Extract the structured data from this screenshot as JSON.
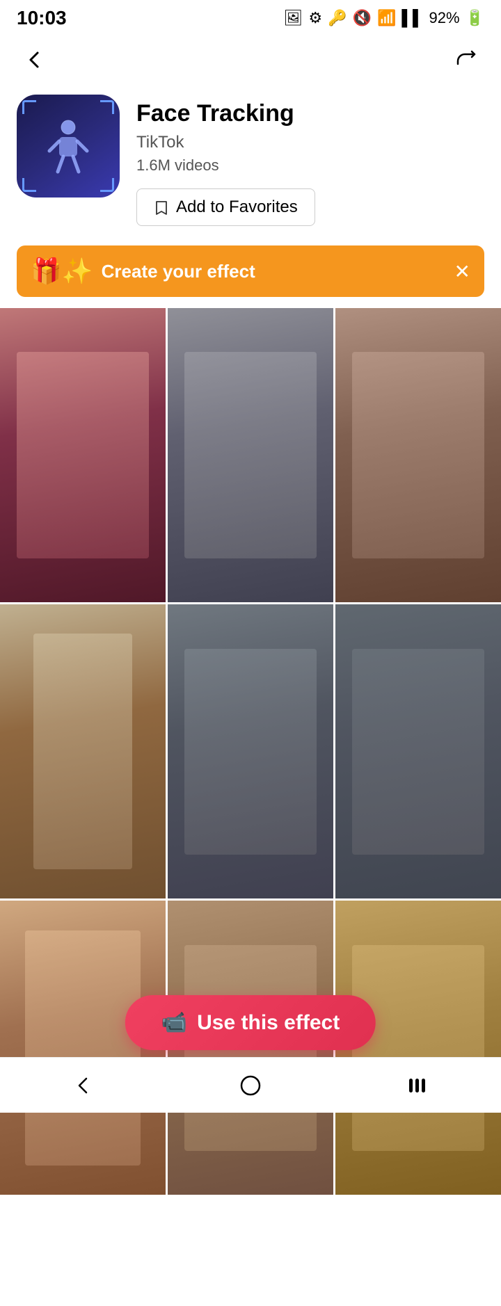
{
  "status": {
    "time": "10:03",
    "battery": "92%",
    "signal_icons": "🔑 🔇 📶"
  },
  "header": {
    "effect_title": "Face Tracking",
    "creator": "TikTok",
    "videos_count": "1.6M videos",
    "add_favorites_label": "Add to Favorites",
    "icon_alt": "face tracking effect icon"
  },
  "banner": {
    "text": "Create your effect",
    "emoji": "🎁"
  },
  "grid": {
    "cells": [
      {
        "id": 1,
        "label": "video-1"
      },
      {
        "id": 2,
        "label": "video-2"
      },
      {
        "id": 3,
        "label": "video-3"
      },
      {
        "id": 4,
        "label": "video-4"
      },
      {
        "id": 5,
        "label": "video-5"
      },
      {
        "id": 6,
        "label": "video-6"
      },
      {
        "id": 7,
        "label": "video-7"
      },
      {
        "id": 8,
        "label": "video-8"
      },
      {
        "id": 9,
        "label": "video-9"
      }
    ]
  },
  "use_effect_btn": {
    "label": "Use this effect",
    "camera_icon": "📹"
  },
  "nav": {
    "back_label": "←",
    "share_label": "↗"
  },
  "bottom_nav": {
    "back": "‹",
    "home": "○",
    "menu": "⫼"
  }
}
